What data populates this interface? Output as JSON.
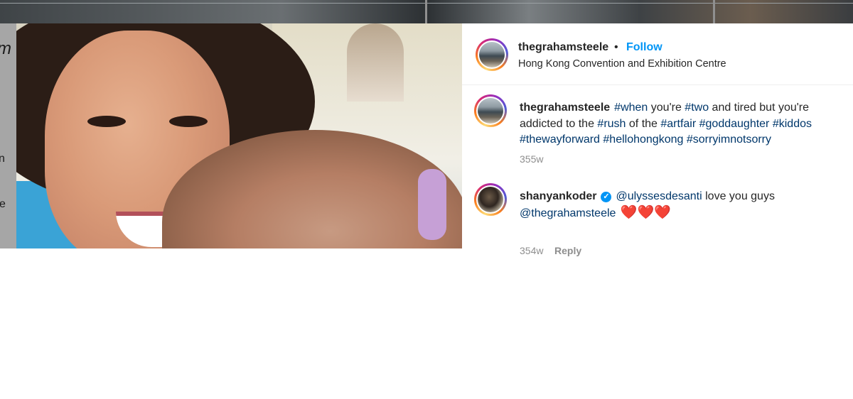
{
  "post": {
    "username": "thegrahamsteele",
    "separator": "•",
    "follow_label": "Follow",
    "location": "Hong Kong Convention and Exhibition Centre"
  },
  "caption": {
    "username": "thegrahamsteele",
    "segments": [
      {
        "text": "#when",
        "type": "hashtag"
      },
      {
        "text": " you're ",
        "type": "text"
      },
      {
        "text": "#two",
        "type": "hashtag"
      },
      {
        "text": " and tired but you're addicted to the ",
        "type": "text"
      },
      {
        "text": "#rush",
        "type": "hashtag"
      },
      {
        "text": " of the ",
        "type": "text"
      },
      {
        "text": "#artfair",
        "type": "hashtag"
      },
      {
        "text": " ",
        "type": "text"
      },
      {
        "text": "#goddaughter",
        "type": "hashtag"
      },
      {
        "text": " ",
        "type": "text"
      },
      {
        "text": "#kiddos",
        "type": "hashtag"
      },
      {
        "text": " ",
        "type": "text"
      },
      {
        "text": "#thewayforward",
        "type": "hashtag"
      },
      {
        "text": " ",
        "type": "text"
      },
      {
        "text": "#hellohongkong",
        "type": "hashtag"
      },
      {
        "text": " ",
        "type": "text"
      },
      {
        "text": "#sorryimnotsorry",
        "type": "hashtag"
      }
    ],
    "time": "355w"
  },
  "comments": [
    {
      "username": "shanyankoder",
      "verified": true,
      "mention1": "@ulyssesdesanti",
      "text": " love you guys ",
      "mention2": "@thegrahamsteele",
      "emoji": "❤️❤️❤️",
      "time": "354w",
      "reply_label": "Reply"
    }
  ],
  "icons": {
    "verified": "verified-badge-icon",
    "heart": "red-heart-emoji"
  },
  "colors": {
    "link_blue": "#0095f6",
    "hashtag": "#00376b",
    "muted": "#8e8e8e",
    "heart": "#e0142b"
  }
}
